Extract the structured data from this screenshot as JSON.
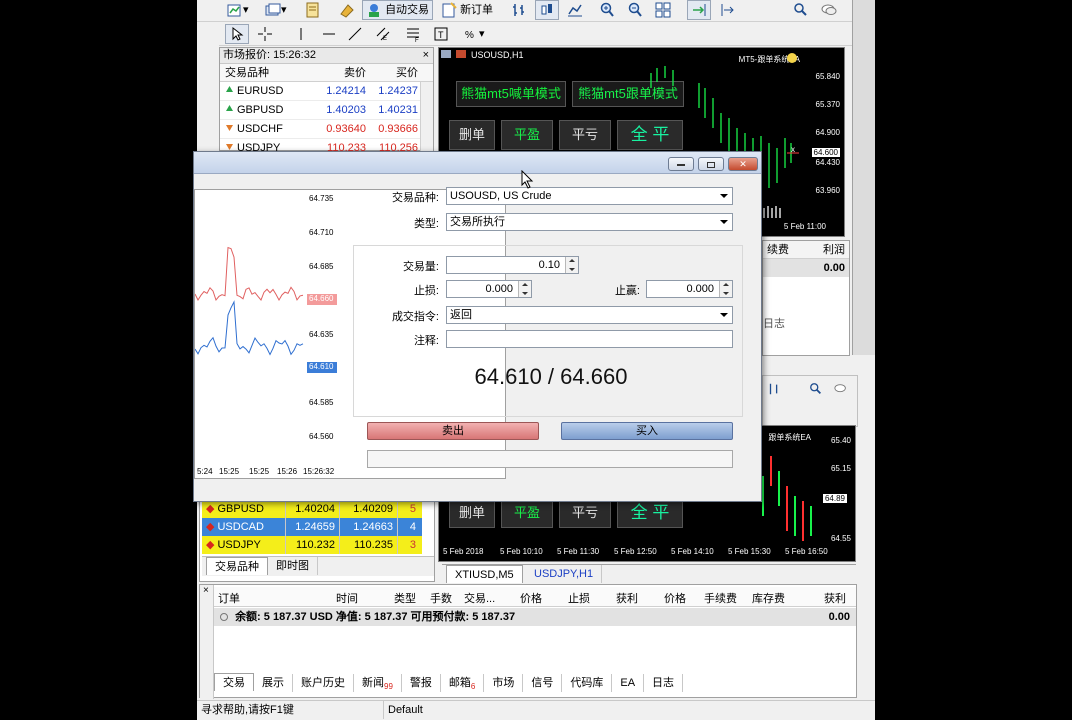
{
  "toolbar": {
    "auto_trade": "自动交易",
    "new_order": "新订单"
  },
  "market_watch": {
    "title": "市场报价: 15:26:32",
    "col_symbol": "交易品种",
    "col_bid": "卖价",
    "col_ask": "买价",
    "rows": [
      {
        "symbol": "EURUSD",
        "bid": "1.24214",
        "ask": "1.24237",
        "dir": "up"
      },
      {
        "symbol": "GBPUSD",
        "bid": "1.40203",
        "ask": "1.40231",
        "dir": "up"
      },
      {
        "symbol": "USDCHF",
        "bid": "0.93640",
        "ask": "0.93666",
        "dir": "dn"
      },
      {
        "symbol": "USDJPY",
        "bid": "110.233",
        "ask": "110.256",
        "dir": "dn"
      }
    ]
  },
  "market_watch2": {
    "rows": [
      {
        "symbol": "GBPUSD",
        "bid": "1.40204",
        "ask": "1.40209",
        "spread": "5",
        "style": "yellow"
      },
      {
        "symbol": "USDCAD",
        "bid": "1.24659",
        "ask": "1.24663",
        "spread": "4",
        "style": "blue"
      },
      {
        "symbol": "USDJPY",
        "bid": "110.232",
        "ask": "110.235",
        "spread": "3",
        "style": "yellow"
      }
    ],
    "tab_symbols": "交易品种",
    "tab_tick": "即时图"
  },
  "chart_top": {
    "title": "USOUSD,H1",
    "ea_label": "MT5-跟单系统EA",
    "btn_call_mode": "熊猫mt5喊单模式",
    "btn_follow_mode": "熊猫mt5跟单模式",
    "btn_delete": "删单",
    "btn_profit": "平盈",
    "btn_loss": "平亏",
    "btn_all": "全 平",
    "prices": [
      "65.840",
      "65.370",
      "64.900",
      "64.600",
      "64.430",
      "63.960"
    ],
    "time_label": "5 Feb 11:00",
    "fee_label": "续费",
    "profit_label": "利润",
    "profit_value": "0.00",
    "log_label": "日志"
  },
  "chart_bottom": {
    "ea_label": "跟单系统EA",
    "btn_delete": "删单",
    "btn_profit": "平盈",
    "btn_loss": "平亏",
    "btn_all": "全 平",
    "prices": [
      "65.40",
      "65.15",
      "64.89",
      "64.55"
    ],
    "times": [
      "5 Feb 2018",
      "5 Feb 10:10",
      "5 Feb 11:30",
      "5 Feb 12:50",
      "5 Feb 14:10",
      "5 Feb 15:30",
      "5 Feb 16:50"
    ],
    "tabs": [
      "XTIUSD,M5",
      "USDJPY,H1"
    ]
  },
  "terminal": {
    "cols": [
      "订单",
      "时间",
      "类型",
      "手数",
      "交易...",
      "价格",
      "止损",
      "获利",
      "价格",
      "手续费",
      "库存费",
      "获利"
    ],
    "summary": "余额: 5 187.37 USD  净值: 5 187.37  可用预付款: 5 187.37",
    "summary_profit": "0.00",
    "tabs": [
      {
        "label": "交易",
        "badge": ""
      },
      {
        "label": "展示",
        "badge": ""
      },
      {
        "label": "账户历史",
        "badge": ""
      },
      {
        "label": "新闻",
        "badge": "99"
      },
      {
        "label": "警报",
        "badge": ""
      },
      {
        "label": "邮箱",
        "badge": "6"
      },
      {
        "label": "市场",
        "badge": ""
      },
      {
        "label": "信号",
        "badge": ""
      },
      {
        "label": "代码库",
        "badge": ""
      },
      {
        "label": "EA",
        "badge": ""
      },
      {
        "label": "日志",
        "badge": ""
      }
    ]
  },
  "status": {
    "help": "寻求帮助,请按F1键",
    "profile": "Default"
  },
  "dialog": {
    "symbol_label": "交易品种:",
    "symbol_value": "USOUSD, US Crude",
    "type_label": "类型:",
    "type_value": "交易所执行",
    "volume_label": "交易量:",
    "volume_value": "0.10",
    "sl_label": "止损:",
    "sl_value": "0.000",
    "tp_label": "止赢:",
    "tp_value": "0.000",
    "fill_label": "成交指令:",
    "fill_value": "返回",
    "comment_label": "注释:",
    "comment_value": "",
    "quote": "64.610 / 64.660",
    "sell": "卖出",
    "buy": "买入",
    "tick_chart": {
      "y_ticks": [
        "64.735",
        "64.710",
        "64.685",
        "64.660",
        "64.635",
        "64.610",
        "64.585",
        "64.560"
      ],
      "ask_marker": "64.660",
      "bid_marker": "64.610",
      "x_ticks": [
        "5:24",
        "15:25",
        "15:25",
        "15:26",
        "15:26:32"
      ]
    }
  }
}
